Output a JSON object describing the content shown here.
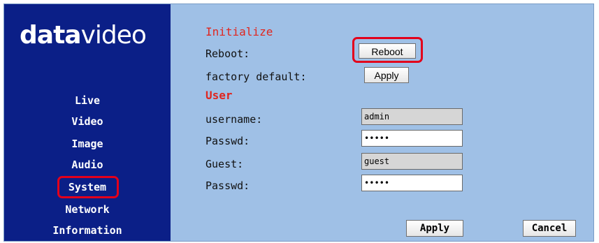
{
  "brand": {
    "logo_bold": "data",
    "logo_light": "video"
  },
  "nav": {
    "items": [
      {
        "label": "Live"
      },
      {
        "label": "Video"
      },
      {
        "label": "Image"
      },
      {
        "label": "Audio"
      },
      {
        "label": "System",
        "selected": true
      },
      {
        "label": "Network"
      },
      {
        "label": "Information"
      }
    ]
  },
  "initialize": {
    "heading": "Initialize",
    "reboot_label": "Reboot:",
    "reboot_button": "Reboot",
    "factory_label": "factory default:",
    "factory_button": "Apply"
  },
  "user": {
    "heading": "User",
    "username_label": "username:",
    "username_value": "admin",
    "passwd_label": "Passwd:",
    "passwd_value": "•••••",
    "guest_label": "Guest:",
    "guest_value": "guest",
    "guest_passwd_label": "Passwd:",
    "guest_passwd_value": "•••••"
  },
  "footer": {
    "apply_button": "Apply",
    "cancel_button": "Cancel"
  },
  "colors": {
    "sidebar": "#0b1f87",
    "content": "#9fc0e6",
    "section_heading": "#e0261f",
    "highlight": "#e3001b"
  }
}
